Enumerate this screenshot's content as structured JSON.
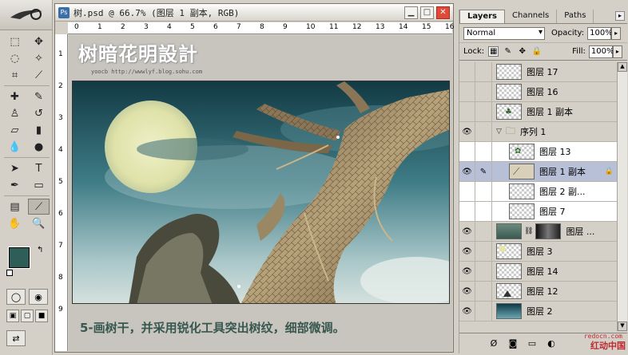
{
  "toolbox": {
    "header_icon": "adobe-feather-icon",
    "tools": [
      "marquee-icon",
      "move-icon",
      "lasso-icon",
      "magic-wand-icon",
      "crop-icon",
      "slice-icon",
      "healing-brush-icon",
      "brush-icon",
      "stamp-icon",
      "history-brush-icon",
      "eraser-icon",
      "gradient-icon",
      "blur-icon",
      "dodge-icon",
      "path-select-icon",
      "type-icon",
      "pen-icon",
      "shape-icon",
      "notes-icon",
      "eyedropper-icon",
      "hand-icon",
      "zoom-icon"
    ],
    "fg_color": "#2f5e59",
    "bg_color": "#3d6e65"
  },
  "document": {
    "title": "树.psd @ 66.7% (图层 1 副本, RGB)",
    "ruler_h": [
      "0",
      "1",
      "2",
      "3",
      "4",
      "5",
      "6",
      "7",
      "8",
      "9",
      "10",
      "11",
      "12",
      "13",
      "14",
      "15",
      "16"
    ],
    "ruler_v": [
      "1",
      "2",
      "3",
      "4",
      "5",
      "6",
      "7",
      "8",
      "9"
    ],
    "watermark": "树暗花明設計",
    "watermark_sub": "yoocb   http://wwwlyf.blog.sohu.com",
    "caption": "5-画树干，并采用锐化工具突出树纹，细部微调。"
  },
  "layers_panel": {
    "tabs": [
      "Layers",
      "Channels",
      "Paths"
    ],
    "blend_mode": "Normal",
    "opacity_label": "Opacity:",
    "opacity": "100%",
    "lock_label": "Lock:",
    "fill_label": "Fill:",
    "fill": "100%",
    "layers": [
      {
        "name": "图层 17",
        "visible": false,
        "type": "layer",
        "indent": false
      },
      {
        "name": "图层 16",
        "visible": false,
        "type": "layer",
        "indent": false
      },
      {
        "name": "图层 1 副本",
        "visible": false,
        "type": "layer",
        "indent": false
      },
      {
        "name": "序列 1",
        "visible": true,
        "type": "group",
        "indent": false
      },
      {
        "name": "图层 13",
        "visible": false,
        "type": "layer",
        "indent": true
      },
      {
        "name": "图层 1 副本",
        "visible": true,
        "type": "layer",
        "indent": true,
        "selected": true
      },
      {
        "name": "图层 2 副...",
        "visible": false,
        "type": "layer",
        "indent": true
      },
      {
        "name": "图层 7",
        "visible": false,
        "type": "layer",
        "indent": true
      },
      {
        "name": "图层 ...",
        "visible": true,
        "type": "masked",
        "indent": false
      },
      {
        "name": "图层 3",
        "visible": true,
        "type": "layer",
        "indent": false
      },
      {
        "name": "图层 14",
        "visible": true,
        "type": "layer",
        "indent": false
      },
      {
        "name": "图层 12",
        "visible": true,
        "type": "layer",
        "indent": false
      },
      {
        "name": "图层 2",
        "visible": true,
        "type": "layer",
        "indent": false
      }
    ],
    "site_url": "redocn.com",
    "site_name": "红动中国"
  }
}
